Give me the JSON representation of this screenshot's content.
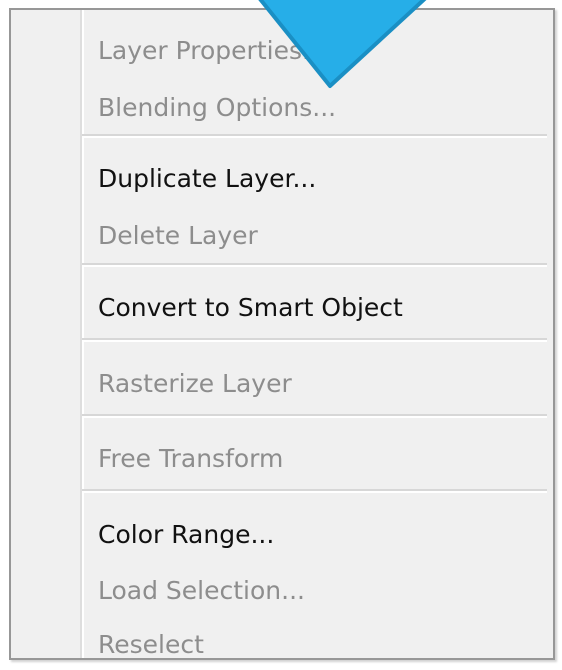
{
  "menu": {
    "items": [
      {
        "label": "Layer Properties...",
        "enabled": false
      },
      {
        "label": "Blending Options...",
        "enabled": false
      },
      {
        "label": "Duplicate Layer...",
        "enabled": true
      },
      {
        "label": "Delete Layer",
        "enabled": false
      },
      {
        "label": "Convert to Smart Object",
        "enabled": true
      },
      {
        "label": "Rasterize Layer",
        "enabled": false
      },
      {
        "label": "Free Transform",
        "enabled": false
      },
      {
        "label": "Color Range...",
        "enabled": true
      },
      {
        "label": "Load Selection...",
        "enabled": false
      },
      {
        "label": "Reselect",
        "enabled": false
      }
    ]
  },
  "colors": {
    "menu_background": "#f0f0f0",
    "menu_border": "#979797",
    "enabled_text": "#111111",
    "disabled_text": "#8d8d8d",
    "pointer_fill": "#26aee8",
    "pointer_stroke": "#1a8fc4"
  },
  "pointer": {
    "icon": "triangle-pointer-icon"
  }
}
